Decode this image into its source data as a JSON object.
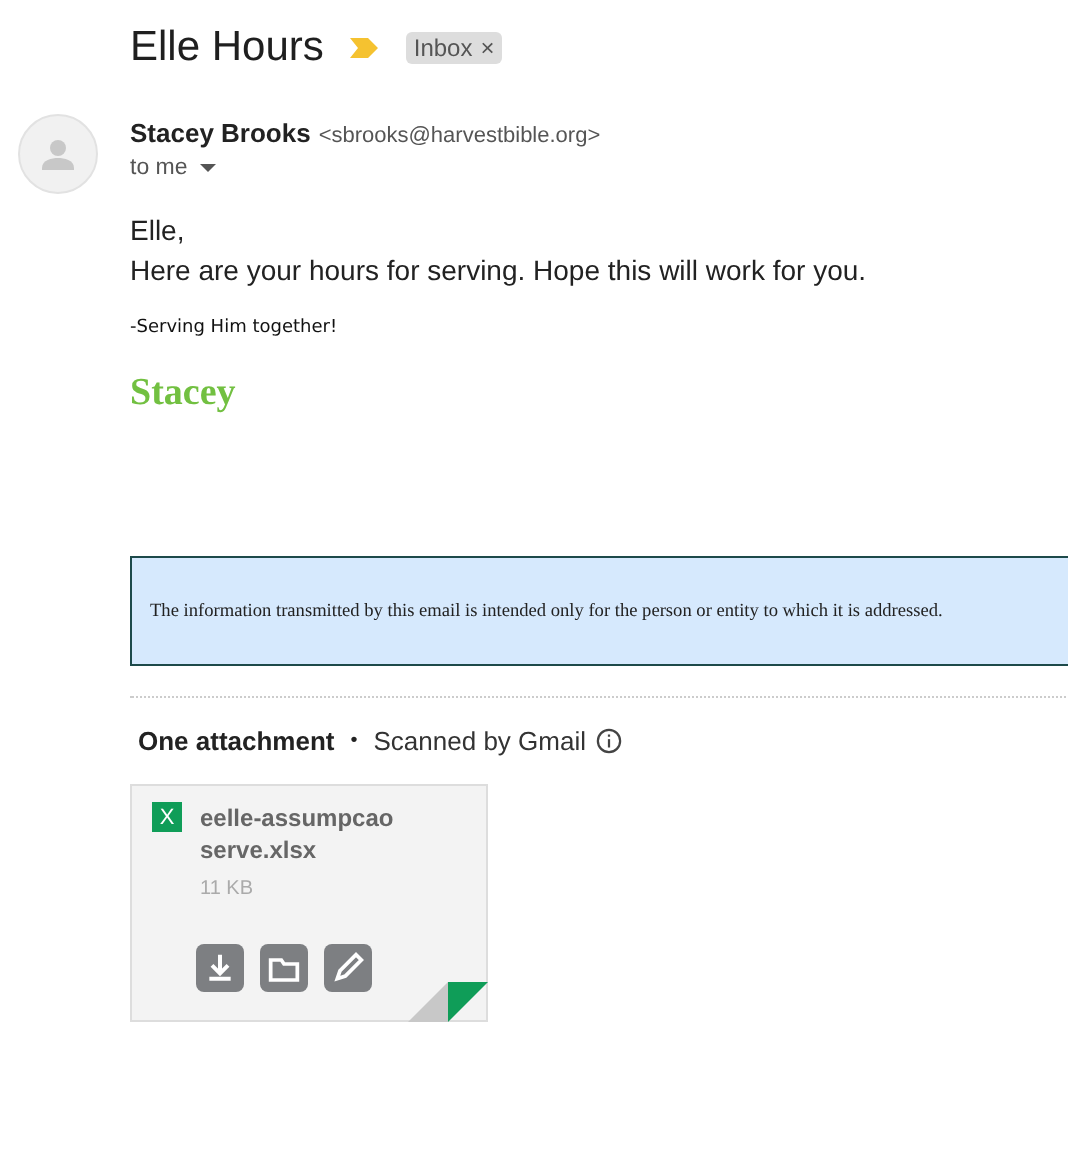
{
  "subject": "Elle Hours",
  "label": {
    "text": "Inbox",
    "close": "×"
  },
  "sender": {
    "name": "Stacey Brooks",
    "email": "<sbrooks@harvestbible.org>",
    "recipient": "to me"
  },
  "body": {
    "greeting": "Elle,",
    "message": "Here are your hours for serving.  Hope this will work for you.",
    "tagline": "-Serving Him together!",
    "signature": "Stacey",
    "disclaimer": "The information transmitted by this email is intended only for the person or entity to which it is addressed."
  },
  "attachments": {
    "heading": "One attachment",
    "separator": "•",
    "scan_note": "Scanned by Gmail",
    "files": [
      {
        "type_letter": "X",
        "name": "eelle-assumpcao serve.xlsx",
        "size": "11 KB"
      }
    ]
  }
}
